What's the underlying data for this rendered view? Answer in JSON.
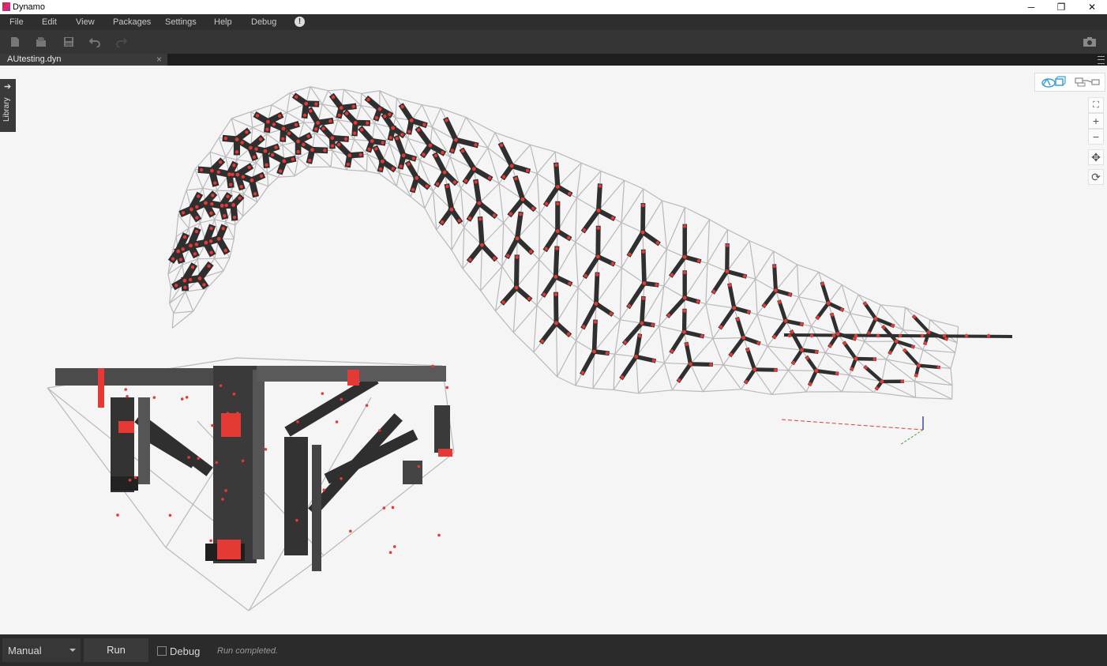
{
  "window": {
    "title": "Dynamo",
    "controls": {
      "minimize": "─",
      "restore": "❐",
      "close": "✕"
    }
  },
  "menu": {
    "items": [
      "File",
      "Edit",
      "View",
      "Packages",
      "Settings",
      "Help",
      "Debug"
    ],
    "alert_glyph": "!"
  },
  "toolbar": {
    "icons": [
      "new-file-icon",
      "open-file-icon",
      "save-icon",
      "undo-icon",
      "redo-icon",
      "screenshot-icon"
    ]
  },
  "tab": {
    "label": "AUtesting.dyn",
    "close_glyph": "×"
  },
  "library": {
    "label": "Library",
    "arrow": "➔"
  },
  "navigation": {
    "fit": "⛶",
    "zoom_in": "+",
    "zoom_out": "−",
    "pan": "✥",
    "orbit": "⟳"
  },
  "statusbar": {
    "run_mode": "Manual",
    "run_label": "Run",
    "debug_label": "Debug",
    "status_text": "Run completed."
  },
  "colors": {
    "menubar": "#2e2e2e",
    "toolbar": "#353535",
    "canvas": "#f5f5f5",
    "status": "#2b2b2b",
    "mesh": "#b8b8b8",
    "steel": "#2f2f2f",
    "node": "#e53935"
  }
}
